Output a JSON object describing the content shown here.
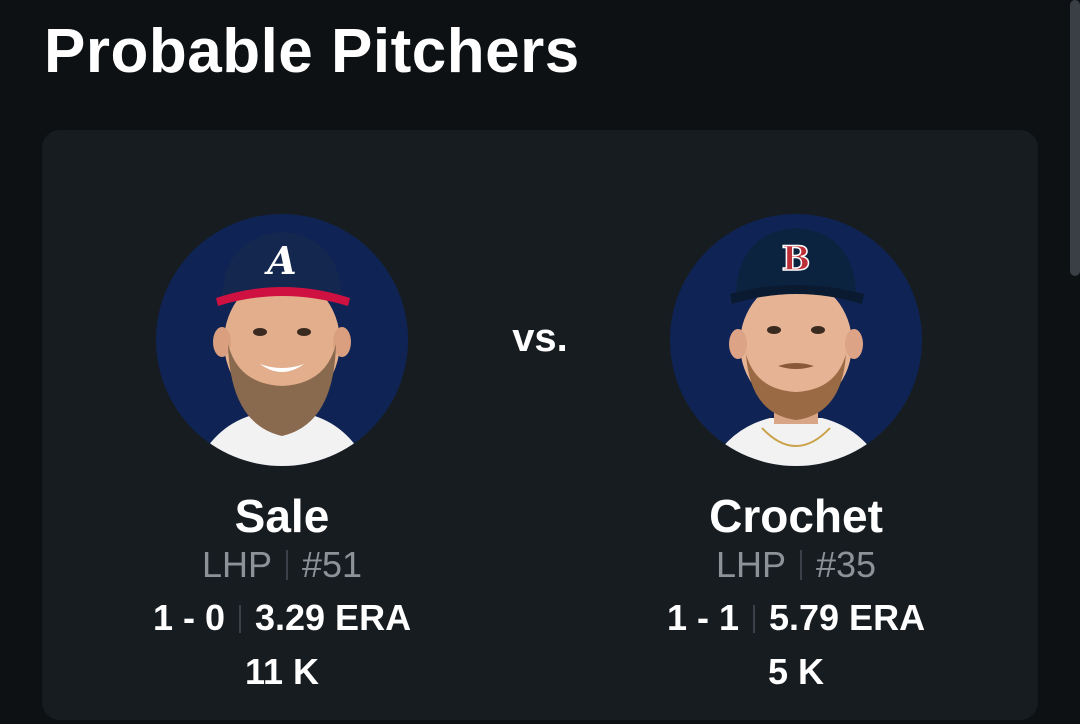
{
  "header": {
    "title": "Probable Pitchers"
  },
  "matchup": {
    "vs_label": "vs.",
    "home": {
      "name": "Sale",
      "throws": "LHP",
      "number": "#51",
      "record": "1 - 0",
      "era": "3.29 ERA",
      "strikeouts": "11 K",
      "cap_logo": "A",
      "cap_color": "#13274f",
      "brim_color": "#ce1141"
    },
    "away": {
      "name": "Crochet",
      "throws": "LHP",
      "number": "#35",
      "record": "1 - 1",
      "era": "5.79 ERA",
      "strikeouts": "5 K",
      "cap_logo": "B",
      "cap_color": "#0c2340",
      "brim_color": "#0c2340"
    }
  },
  "colors": {
    "background": "#0e1114",
    "card": "#171c21",
    "avatar_bg": "#0f2454",
    "muted_text": "#8c9298"
  }
}
